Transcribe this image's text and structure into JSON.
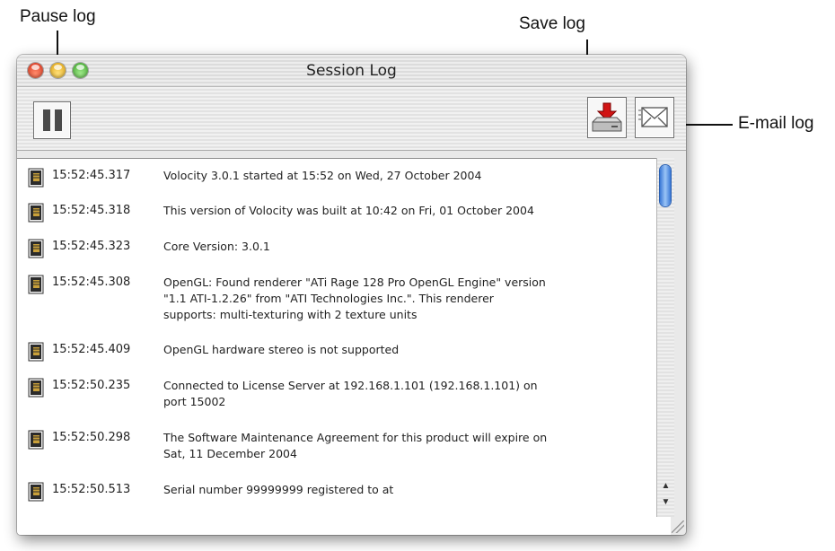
{
  "callouts": {
    "pause": "Pause log",
    "save": "Save log",
    "email": "E-mail log"
  },
  "window": {
    "title": "Session Log"
  },
  "toolbar": {
    "pause_icon": "pause-icon",
    "save_icon": "save-disk-icon",
    "email_icon": "envelope-icon"
  },
  "log": {
    "entries": [
      {
        "time": "15:52:45.317",
        "message": "Volocity 3.0.1 started at 15:52 on Wed, 27 October 2004"
      },
      {
        "time": "15:52:45.318",
        "message": "This version of Volocity was built at 10:42 on Fri, 01 October 2004"
      },
      {
        "time": "15:52:45.323",
        "message": "Core Version: 3.0.1"
      },
      {
        "time": "15:52:45.308",
        "message": "OpenGL: Found renderer \"ATi Rage 128 Pro OpenGL Engine\" version\n\"1.1 ATI-1.2.26\" from \"ATI Technologies Inc.\".  This renderer\nsupports: multi-texturing with 2 texture units"
      },
      {
        "time": "15:52:45.409",
        "message": "OpenGL hardware stereo is not supported"
      },
      {
        "time": "15:52:50.235",
        "message": "Connected to License Server at 192.168.1.101 (192.168.1.101) on\nport 15002"
      },
      {
        "time": "15:52:50.298",
        "message": "The Software Maintenance Agreement for this product will expire on\nSat, 11 December 2004"
      },
      {
        "time": "15:52:50.513",
        "message": "Serial number 99999999 registered to   at"
      }
    ]
  }
}
